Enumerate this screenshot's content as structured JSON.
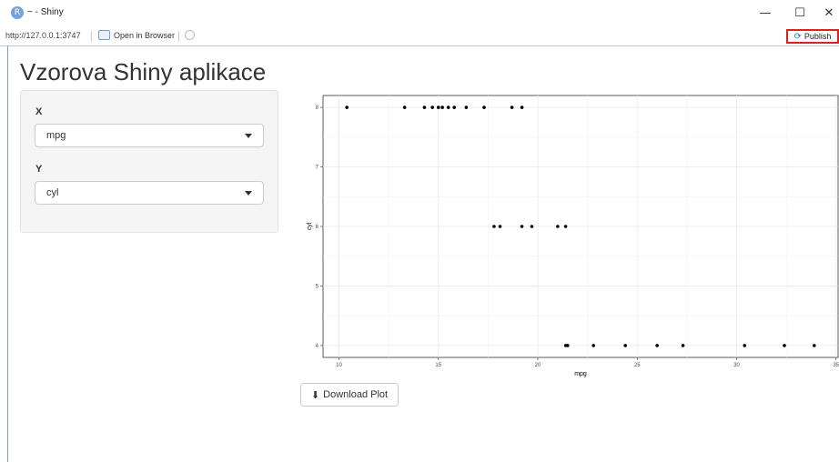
{
  "window": {
    "title": "~ - Shiny",
    "app_icon": "R",
    "min": "—",
    "max": "☐",
    "close": "✕"
  },
  "address": {
    "url": "http://127.0.0.1:3747",
    "open_in_browser": "Open in Browser",
    "publish": "Publish"
  },
  "page": {
    "title": "Vzorova Shiny aplikace"
  },
  "inputs": {
    "x_label": "X",
    "x_value": "mpg",
    "y_label": "Y",
    "y_value": "cyl"
  },
  "buttons": {
    "download": "Download Plot"
  },
  "colors": {
    "publish_border": "#e02020",
    "publish_icon": "#2a7bd6",
    "panel": "#f5f5f5"
  },
  "chart_data": {
    "type": "scatter",
    "title": "",
    "xlabel": "mpg",
    "ylabel": "cyl",
    "xlim": [
      9.2,
      35.1
    ],
    "ylim": [
      3.8,
      8.2
    ],
    "xticks": [
      10,
      15,
      20,
      25,
      30,
      35
    ],
    "yticks": [
      4,
      5,
      6,
      7,
      8
    ],
    "grid": true,
    "points": [
      [
        10.4,
        8
      ],
      [
        13.3,
        8
      ],
      [
        14.3,
        8
      ],
      [
        14.7,
        8
      ],
      [
        15.0,
        8
      ],
      [
        15.2,
        8
      ],
      [
        15.5,
        8
      ],
      [
        15.8,
        8
      ],
      [
        16.4,
        8
      ],
      [
        17.3,
        8
      ],
      [
        18.7,
        8
      ],
      [
        19.2,
        8
      ],
      [
        17.8,
        6
      ],
      [
        18.1,
        6
      ],
      [
        19.2,
        6
      ],
      [
        19.7,
        6
      ],
      [
        21.0,
        6
      ],
      [
        21.4,
        6
      ],
      [
        21.4,
        4
      ],
      [
        21.5,
        4
      ],
      [
        22.8,
        4
      ],
      [
        24.4,
        4
      ],
      [
        26.0,
        4
      ],
      [
        27.3,
        4
      ],
      [
        30.4,
        4
      ],
      [
        32.4,
        4
      ],
      [
        33.9,
        4
      ]
    ]
  }
}
